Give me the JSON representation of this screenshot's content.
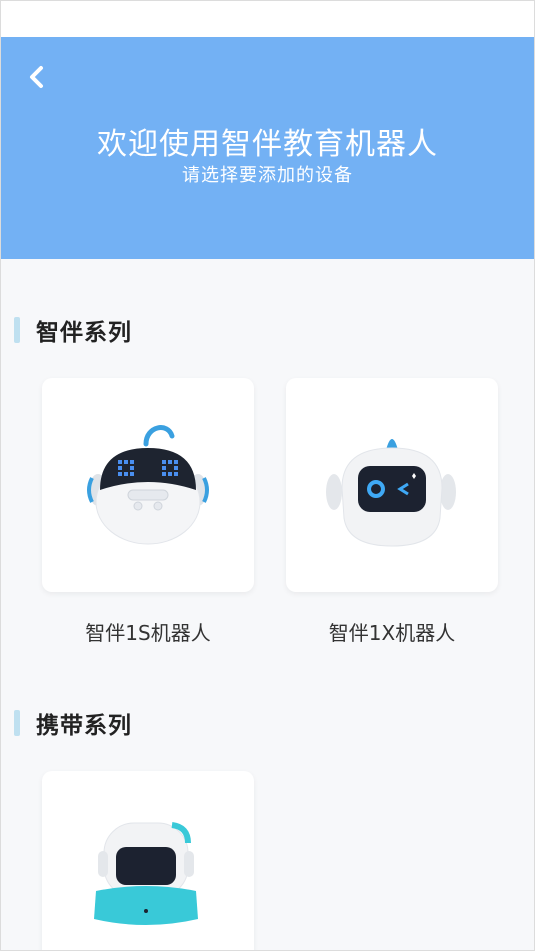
{
  "header": {
    "title": "欢迎使用智伴教育机器人",
    "subtitle": "请选择要添加的设备",
    "background_color": "#73b1f4",
    "back_icon": "chevron-left-icon"
  },
  "sections": [
    {
      "label": "智伴系列",
      "devices": [
        {
          "name": "智伴1S机器人",
          "image": "robot-1s-image"
        },
        {
          "name": "智伴1X机器人",
          "image": "robot-1x-image"
        }
      ]
    },
    {
      "label": "携带系列",
      "devices": [
        {
          "name": "",
          "image": "portable-robot-image"
        }
      ]
    }
  ],
  "colors": {
    "accent": "#73b1f4",
    "section_bar": "#bfe0f0",
    "robot_accent": "#3aa0e0",
    "portable_accent": "#39c9d8"
  }
}
